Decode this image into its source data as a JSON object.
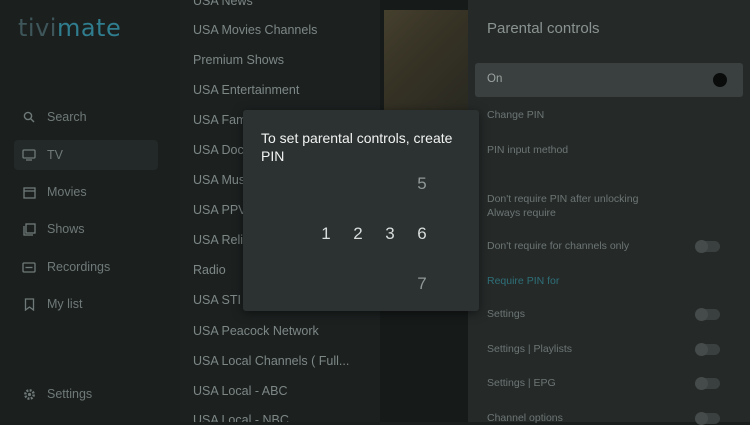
{
  "app": {
    "logo_part1": "tivi",
    "logo_part2": "mate"
  },
  "nav": {
    "items": [
      {
        "label": "Search",
        "icon": "search-icon"
      },
      {
        "label": "TV",
        "icon": "tv-icon"
      },
      {
        "label": "Movies",
        "icon": "movies-icon"
      },
      {
        "label": "Shows",
        "icon": "shows-icon"
      },
      {
        "label": "Recordings",
        "icon": "recordings-icon"
      },
      {
        "label": "My list",
        "icon": "bookmark-icon"
      },
      {
        "label": "Settings",
        "icon": "gear-icon"
      }
    ]
  },
  "groups": [
    "USA News",
    "USA Movies Channels",
    "Premium Shows",
    "USA Entertainment",
    "USA Fam",
    "USA Doc",
    "USA Mus",
    "USA PPV",
    "USA Reli",
    "Radio",
    "USA STI",
    "USA Peacock Network",
    "USA Local Channels ( Full...",
    "USA Local - ABC",
    "USA Local - NBC"
  ],
  "panel": {
    "title": "Parental controls",
    "on_label": "On",
    "items": [
      "Change PIN",
      "PIN input method",
      "Don't require PIN after unlocking",
      "Always require",
      "Don't require for channels only",
      "Require PIN for",
      "Settings",
      "Settings | Playlists",
      "Settings | EPG",
      "Channel options"
    ]
  },
  "dialog": {
    "title": "To set parental controls, create PIN",
    "digits": {
      "d1": "1",
      "d2": "2",
      "d3": "3",
      "d5": "5",
      "d6": "6",
      "d7": "7"
    }
  },
  "colors": {
    "background": "#1a1f1e",
    "dialog": "#2c3231",
    "accent": "#2f7d8e"
  }
}
